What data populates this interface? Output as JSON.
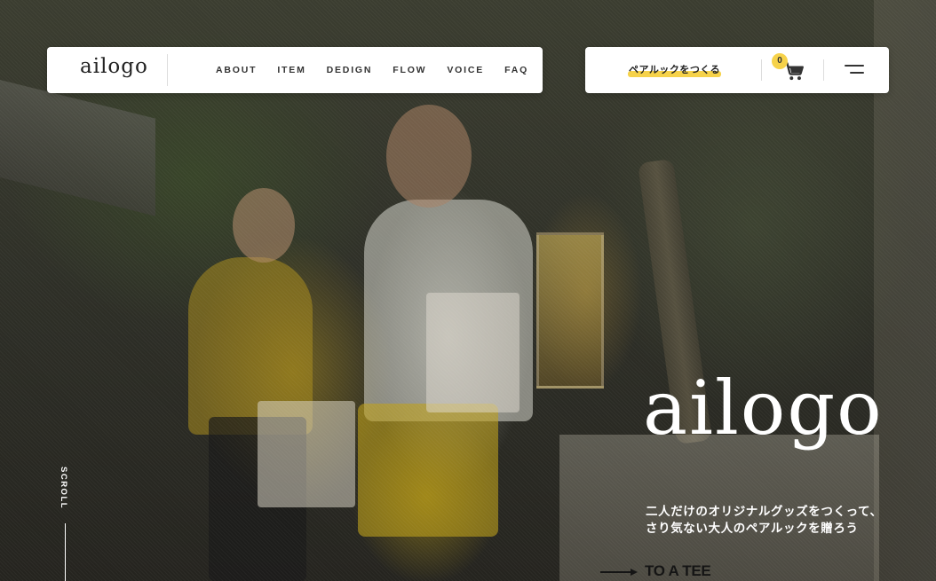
{
  "header": {
    "logo": "ailogo",
    "nav": [
      "ABOUT",
      "ITEM",
      "DEDIGN",
      "FLOW",
      "VOICE",
      "FAQ"
    ]
  },
  "actions": {
    "cta_label": "ペアルックをつくる",
    "cart_count": "0",
    "cart_icon": "cart-icon",
    "menu_icon": "hamburger-menu-icon"
  },
  "hero": {
    "brand": "ailogo",
    "tagline_line1": "二人だけのオリジナルグッズをつくって、",
    "tagline_line2": "さり気ない大人のペアルックを贈ろう",
    "scroll_label": "SCROLL",
    "sign_text": "TO A TEE"
  },
  "colors": {
    "accent_yellow": "#f6d24a",
    "nav_bg": "#ffffff",
    "text_dark": "#333333"
  }
}
